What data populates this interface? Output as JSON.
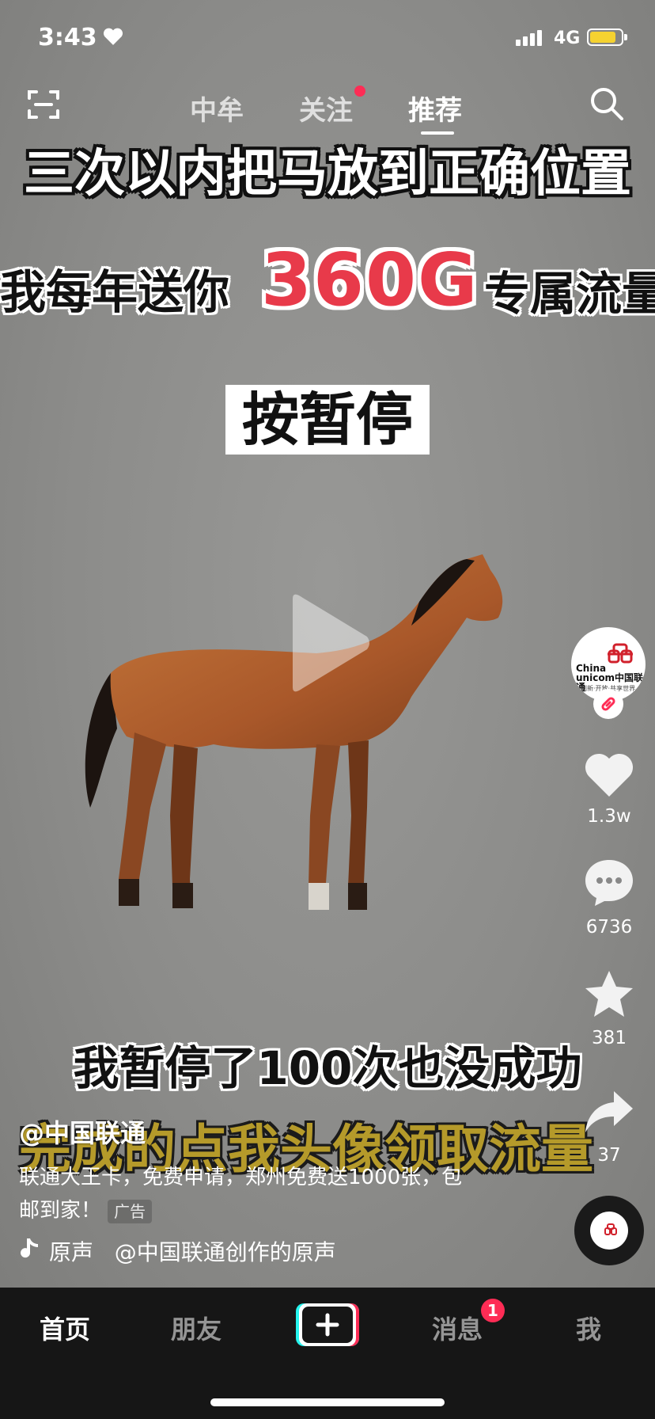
{
  "status_bar": {
    "time": "3:43",
    "network": "4G"
  },
  "top_nav": {
    "tabs": [
      {
        "label": "中牟"
      },
      {
        "label": "关注"
      },
      {
        "label": "推荐"
      }
    ],
    "active_tab": "推荐"
  },
  "video_overlay": {
    "title": "三次以内把马放到正确位置",
    "offer_prefix": "我每年送你",
    "offer_amount": "360G",
    "offer_suffix": "专属流量",
    "pause_label": "按暂停",
    "caption_1": "我暂停了100次也没成功",
    "caption_2": "完成的点我头像领取流量"
  },
  "right_rail": {
    "avatar_brand": "China unicom中国联通",
    "avatar_tagline": "创新·开放·共享世界",
    "likes": "1.3w",
    "comments": "6736",
    "favorites": "381",
    "shares": "37"
  },
  "post": {
    "account": "@中国联通",
    "description": "联通大王卡，免费申请，郑州免费送1000张，包邮到家！",
    "ad_label": "广告",
    "music_label": "原声",
    "music_source": "@中国联通创作的原声"
  },
  "bottom_nav": {
    "tabs": [
      {
        "label": "首页"
      },
      {
        "label": "朋友"
      },
      {
        "label": "消息"
      },
      {
        "label": "我"
      }
    ],
    "message_badge": "1"
  },
  "colors": {
    "accent": "#fe2c55",
    "offer_red": "#e83a4a",
    "caption_gold": "#b59a2a",
    "battery": "#f5d230",
    "tabbar_bg": "#161616"
  },
  "icons": [
    "heart-icon",
    "scan-icon",
    "search-icon",
    "play-icon",
    "like-icon",
    "comment-icon",
    "star-icon",
    "share-icon",
    "music-note-icon",
    "plus-icon",
    "link-icon"
  ]
}
